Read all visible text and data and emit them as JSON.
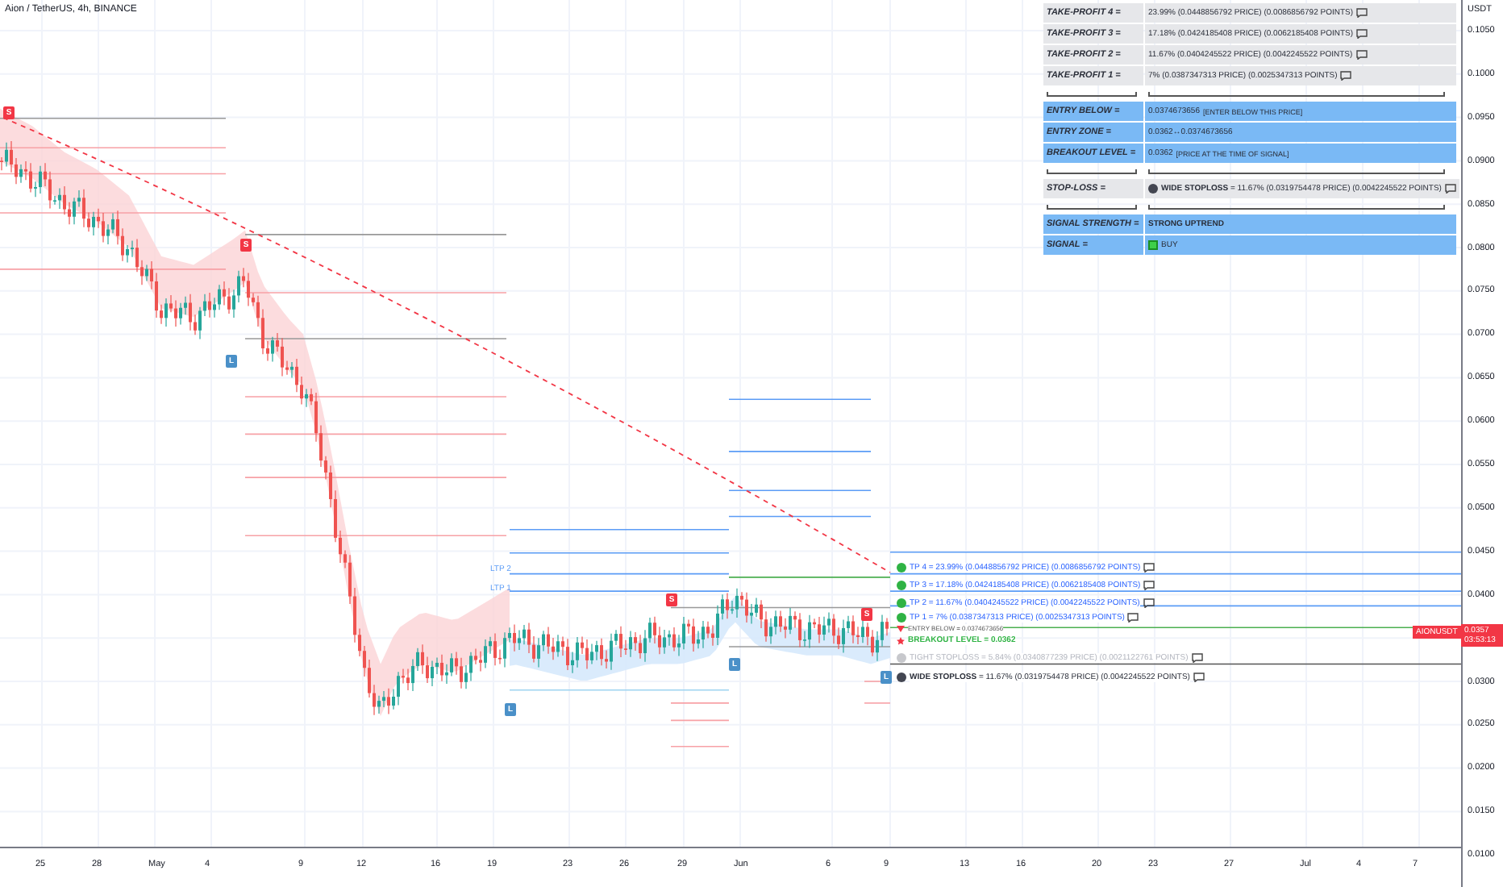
{
  "header": {
    "title": "Aion / TetherUS, 4h, BINANCE"
  },
  "table": {
    "rows": [
      {
        "kind": "grey",
        "label": "TAKE-PROFIT 4 =",
        "value": "23.99% (0.0448856792 PRICE) (0.0086856792 POINTS)",
        "comment": true
      },
      {
        "kind": "grey",
        "label": "TAKE-PROFIT 3 =",
        "value": "17.18% (0.0424185408 PRICE) (0.0062185408 POINTS)",
        "comment": true
      },
      {
        "kind": "grey",
        "label": "TAKE-PROFIT 2 =",
        "value": "11.67% (0.0404245522 PRICE) (0.0042245522 POINTS)",
        "comment": true
      },
      {
        "kind": "grey",
        "label": "TAKE-PROFIT 1 =",
        "value": "7% (0.0387347313 PRICE) (0.0025347313 POINTS)",
        "comment": true
      },
      {
        "kind": "separator"
      },
      {
        "kind": "blue",
        "label": "ENTRY BELOW =",
        "value": "0.0374673656",
        "note": "[ENTER BELOW THIS PRICE]"
      },
      {
        "kind": "blue",
        "label": "ENTRY ZONE =",
        "value": "0.0362↔0.0374673656"
      },
      {
        "kind": "blue",
        "label": "BREAKOUT LEVEL =",
        "value": "0.0362",
        "note": "[PRICE AT THE TIME OF SIGNAL]"
      },
      {
        "kind": "separator"
      },
      {
        "kind": "stop",
        "label": "STOP-LOSS =",
        "value": "**WIDE STOPLOSS** = 11.67% (0.0319754478 PRICE) (0.0042245522 POINTS)",
        "comment": true
      },
      {
        "kind": "separator"
      },
      {
        "kind": "blue",
        "label": "SIGNAL STRENGTH =",
        "value": "STRONG UPTREND",
        "bold": true
      },
      {
        "kind": "signal",
        "label": "SIGNAL =",
        "value": "BUY"
      }
    ]
  },
  "chart_labels": {
    "ltp": [
      "LTP 2",
      "LTP 1"
    ],
    "signals": [
      {
        "kind": "short",
        "text": "S"
      },
      {
        "kind": "short",
        "text": "S"
      },
      {
        "kind": "long",
        "text": "L"
      },
      {
        "kind": "long",
        "text": "L"
      },
      {
        "kind": "short",
        "text": "S"
      },
      {
        "kind": "long",
        "text": "L"
      },
      {
        "kind": "short",
        "text": "S"
      },
      {
        "kind": "long",
        "text": "L"
      }
    ],
    "levels": [
      {
        "kind": "tp",
        "text": "TP 4 = 23.99% (0.0448856792 PRICE) (0.0086856792 POINTS)",
        "comment": true
      },
      {
        "kind": "tp",
        "text": "TP 3 = 17.18% (0.0424185408 PRICE) (0.0062185408 POINTS)",
        "comment": true
      },
      {
        "kind": "tp",
        "text": "TP 2 = 11.67% (0.0404245522 PRICE) (0.0042245522 POINTS)",
        "comment": true
      },
      {
        "kind": "tp",
        "text": "TP 1 = 7% (0.0387347313 PRICE) (0.0025347313 POINTS)",
        "comment": true
      },
      {
        "kind": "entry",
        "text": "ENTRY BELOW = 0.0374673656"
      },
      {
        "kind": "breakout",
        "text": "BREAKOUT LEVEL = 0.0362"
      },
      {
        "kind": "tight_stop",
        "text": "TIGHT STOPLOSS = 5.84% (0.0340877239 PRICE) (0.0021122761 POINTS)",
        "comment": true
      },
      {
        "kind": "wide_stop",
        "text": "**WIDE STOPLOSS** = 11.67% (0.0319754478 PRICE) (0.0042245522 POINTS)",
        "comment": true
      }
    ]
  },
  "price_axis": {
    "unit": "USDT",
    "ticks": [
      "0.1050",
      "0.1000",
      "0.0950",
      "0.0900",
      "0.0850",
      "0.0800",
      "0.0750",
      "0.0700",
      "0.0650",
      "0.0600",
      "0.0550",
      "0.0500",
      "0.0450",
      "0.0400",
      "0.0300",
      "0.0250",
      "0.0200",
      "0.0150",
      "0.0100"
    ]
  },
  "time_axis": {
    "ticks": [
      "25",
      "28",
      "May",
      "4",
      "9",
      "12",
      "16",
      "19",
      "23",
      "26",
      "29",
      "Jun",
      "6",
      "9",
      "13",
      "16",
      "20",
      "23",
      "27",
      "Jul",
      "4",
      "7"
    ]
  },
  "last_price": {
    "symbol": "AIONUSDT",
    "price": "0.0357",
    "countdown": "03:53:13"
  }
}
